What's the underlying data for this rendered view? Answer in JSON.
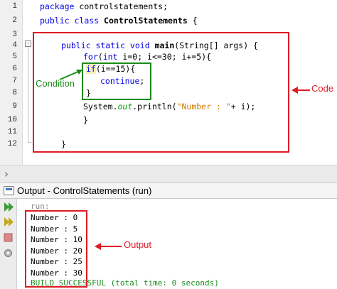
{
  "editor": {
    "line_numbers": [
      "1",
      "2",
      "3",
      "4",
      "5",
      "6",
      "7",
      "8",
      "9",
      "10",
      "11",
      "12"
    ],
    "fold_marker": "-",
    "code": {
      "l1_kw": "package",
      "l1_rest": " controlstatements;",
      "l2_kw1": "public",
      "l2_kw2": "class",
      "l2_name": "ControlStatements",
      "l2_rest": " {",
      "l4_kw": "public static void",
      "l4_name": "main",
      "l4_rest": "(String[] args) {",
      "l5_kw1": "for",
      "l5_mid1": "(",
      "l5_kw2": "int",
      "l5_rest": " i=0; i<=30; i+=5){",
      "l6_kw": "if",
      "l6_rest": "(i==15){",
      "l7_kw": "continue",
      "l7_rest": ";",
      "l8": "}",
      "l9_pre": "System.",
      "l9_field": "out",
      "l9_mid": ".println(",
      "l9_str": "\"Number : \"",
      "l9_rest": "+ i);",
      "l10": "}",
      "l12": "}"
    }
  },
  "annotations": {
    "condition_label": "Condition",
    "code_label": "Code",
    "output_label": "Output",
    "colors": {
      "red": "#e01b24",
      "green": "#1a8c1a"
    }
  },
  "output_panel": {
    "tab_title": "Output - ControlStatements (run)",
    "toolbar_icons": [
      "run-again-icon",
      "rerun-icon",
      "stop-icon",
      "settings-icon"
    ],
    "lines": [
      "run:",
      "Number : 0",
      "Number : 5",
      "Number : 10",
      "Number : 20",
      "Number : 25",
      "Number : 30",
      "BUILD SUCCESSFUL (total time: 0 seconds)"
    ],
    "colors": {
      "run": "#888888",
      "normal": "#000000",
      "success": "#1a8c1a"
    }
  }
}
